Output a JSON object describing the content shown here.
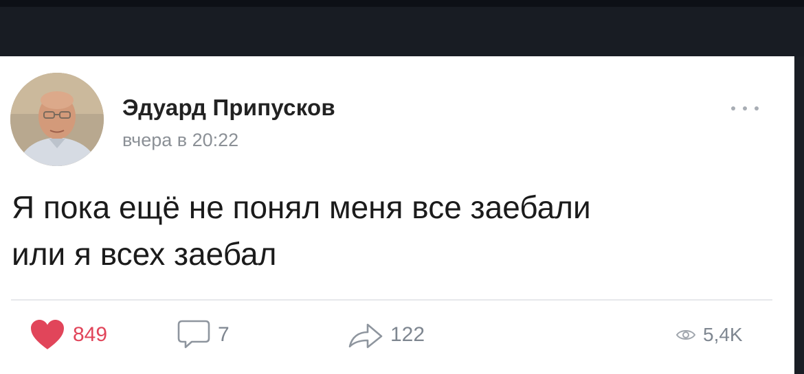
{
  "post": {
    "author": "Эдуард Припусков",
    "time": "вчера в 20:22",
    "text_line1": "Я пока ещё не понял меня все заебали",
    "text_line2": "или я всех заебал"
  },
  "actions": {
    "likes": "849",
    "comments": "7",
    "shares": "122",
    "views": "5,4K"
  },
  "icons": {
    "like": "heart-icon",
    "comment": "comment-bubble-icon",
    "share": "share-arrow-icon",
    "views": "eye-icon",
    "more": "more-dots-icon"
  },
  "colors": {
    "like": "#e1455a",
    "muted": "#7e8690",
    "text": "#1b1b1b",
    "background": "#181c23",
    "card": "#ffffff"
  }
}
